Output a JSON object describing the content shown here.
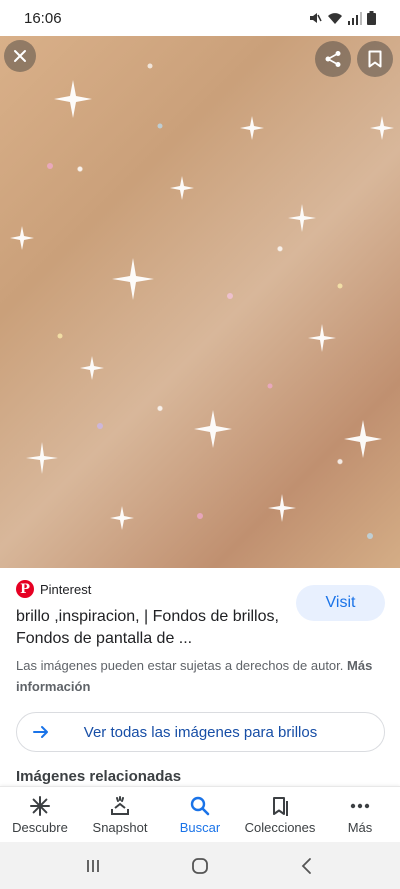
{
  "status_bar": {
    "time": "16:06",
    "icons": [
      "mute-icon",
      "wifi-icon",
      "signal-icon",
      "battery-icon"
    ]
  },
  "viewer": {
    "image_description_icons": [
      "close-icon",
      "share-icon",
      "bookmark-icon"
    ]
  },
  "result": {
    "source": "Pinterest",
    "source_logo": "P",
    "title": "brillo ,inspiracion, | Fondos de brillos, Fondos de pantalla de ...",
    "visit_label": "Visit",
    "copyright_text": "Las imágenes pueden estar sujetas a derechos de autor.",
    "copyright_link": "Más información"
  },
  "see_all": {
    "label": "Ver todas las imágenes para brillos"
  },
  "related": {
    "heading": "Imágenes relacionadas"
  },
  "bottom_nav": {
    "items": [
      {
        "label": "Descubre",
        "icon": "asterisk-icon",
        "active": false
      },
      {
        "label": "Snapshot",
        "icon": "snapshot-icon",
        "active": false
      },
      {
        "label": "Buscar",
        "icon": "search-icon",
        "active": true
      },
      {
        "label": "Colecciones",
        "icon": "collections-icon",
        "active": false
      },
      {
        "label": "Más",
        "icon": "more-icon",
        "active": false
      }
    ]
  },
  "colors": {
    "accent": "#1a73e8",
    "pinterest_red": "#e60023",
    "visit_bg": "#e8f0fe"
  }
}
